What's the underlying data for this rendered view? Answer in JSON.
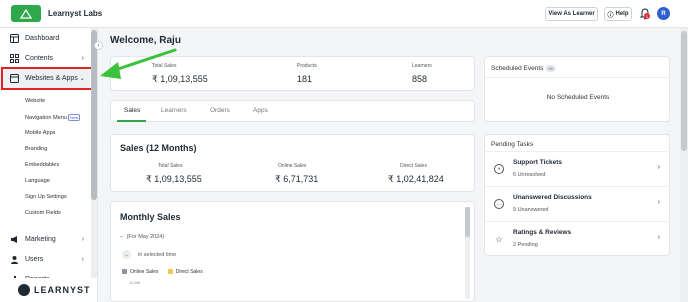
{
  "header": {
    "brand": "Learnyst Labs",
    "view_as_learner": "View As Learner",
    "help": "Help",
    "notification_count": "1",
    "avatar_initial": "R"
  },
  "sidebar": {
    "items": [
      {
        "label": "Dashboard",
        "icon": "dashboard-icon"
      },
      {
        "label": "Contents",
        "icon": "grid-icon"
      },
      {
        "label": "Websites & Apps",
        "icon": "browser-icon"
      },
      {
        "label": "Marketing",
        "icon": "megaphone-icon"
      },
      {
        "label": "Users",
        "icon": "user-icon"
      },
      {
        "label": "Reports",
        "icon": "chart-icon"
      }
    ],
    "sub_items": [
      "Website",
      "Navigation Menu",
      "Mobile Apps",
      "Branding",
      "Embeddables",
      "Language",
      "Sign Up Settings",
      "Custom Fields"
    ],
    "new_tag": "New",
    "footer_brand": "LEARNYST"
  },
  "main": {
    "welcome": "Welcome, Raju",
    "stats": [
      {
        "label": "Total Sales",
        "value": "₹ 1,09,13,555"
      },
      {
        "label": "Products",
        "value": "181"
      },
      {
        "label": "Learners",
        "value": "858"
      }
    ],
    "tabs": [
      "Sales",
      "Learners",
      "Orders",
      "Apps"
    ],
    "sales_12": {
      "title": "Sales (12 Months)",
      "stats": [
        {
          "label": "Total Sales",
          "value": "₹ 1,09,13,555"
        },
        {
          "label": "Online Sales",
          "value": "₹ 6,71,731"
        },
        {
          "label": "Direct Sales",
          "value": "₹ 1,02,41,824"
        }
      ]
    },
    "monthly": {
      "title": "Monthly Sales",
      "period": "(For May 2024)",
      "dash": "–",
      "selected_time": "in selected time",
      "legend": [
        "Online Sales",
        "Direct Sales"
      ],
      "axis_tick": "12.5M",
      "colors": {
        "online": "#8a93a6",
        "direct": "#f2c94c"
      }
    }
  },
  "right": {
    "scheduled": {
      "title": "Scheduled Events",
      "count": "00",
      "empty": "No Scheduled Events"
    },
    "pending": {
      "title": "Pending Tasks",
      "tasks": [
        {
          "title": "Support Tickets",
          "sub": "6 Unresolved",
          "icon": "headset-icon"
        },
        {
          "title": "Unanswered Discussions",
          "sub": "9 Unanswered",
          "icon": "chat-icon"
        },
        {
          "title": "Ratings & Reviews",
          "sub": "2 Pending",
          "icon": "star-icon"
        }
      ]
    }
  },
  "colors": {
    "accent": "#2ea84a",
    "highlight": "#e02424",
    "arrow": "#3cc23c"
  }
}
